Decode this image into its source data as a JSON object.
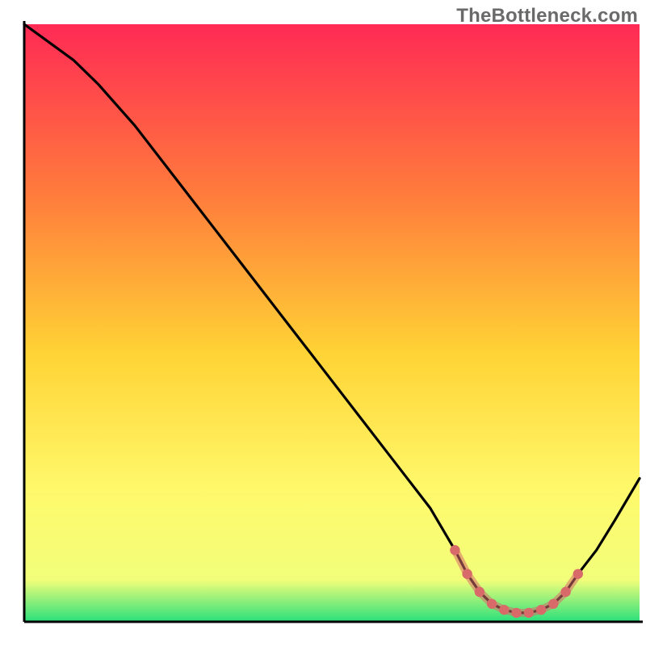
{
  "watermark": "TheBottleneck.com",
  "colors": {
    "axis": "#000000",
    "curve": "#000000",
    "dot": "#d86a6a",
    "dot_halo": "#d86a6a",
    "grad_top": "#ff2a55",
    "grad_mid_high": "#ff7a3c",
    "grad_mid": "#ffd335",
    "grad_mid_low": "#fff96b",
    "grad_bottom_band": "#f2fe7a",
    "grad_green": "#29e07b"
  },
  "chart_data": {
    "type": "line",
    "title": "",
    "xlabel": "",
    "ylabel": "",
    "xlim": [
      0,
      100
    ],
    "ylim": [
      0,
      100
    ],
    "series": [
      {
        "name": "bottleneck-curve",
        "x": [
          0,
          4,
          8,
          12,
          18,
          24,
          30,
          36,
          42,
          48,
          54,
          60,
          66,
          70,
          72,
          74,
          76,
          78,
          80,
          82,
          84,
          86,
          88,
          90,
          93,
          96,
          100
        ],
        "y": [
          100,
          97,
          94,
          90,
          83,
          75,
          67,
          59,
          51,
          43,
          35,
          27,
          19,
          12,
          8,
          5,
          3,
          2,
          1.5,
          1.5,
          2,
          3,
          5,
          8,
          12,
          17,
          24
        ]
      }
    ],
    "highlight_dots": {
      "name": "low-bottleneck-zone",
      "x": [
        70,
        72,
        74,
        76,
        78,
        80,
        82,
        84,
        86,
        88,
        90
      ],
      "y": [
        12,
        8,
        5,
        3,
        2,
        1.5,
        1.5,
        2,
        3,
        5,
        8
      ]
    }
  }
}
